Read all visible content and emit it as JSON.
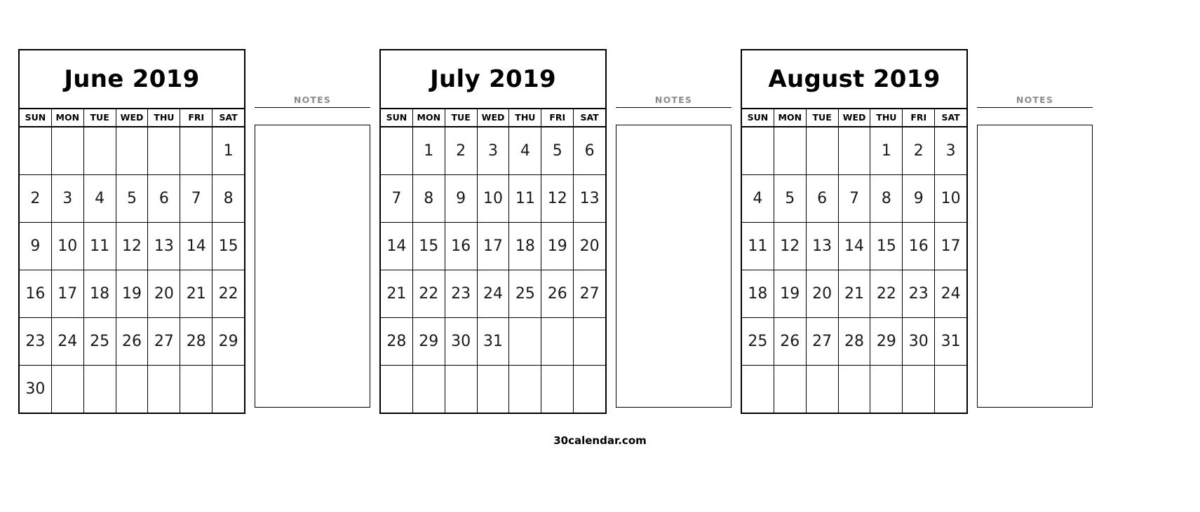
{
  "page": {
    "footer": "30calendar.com",
    "notes_label": "NOTES",
    "background": "#ffffff",
    "notes_label_color": "#8c8c8c",
    "border_color": "#000000"
  },
  "weekdays": [
    "SUN",
    "MON",
    "TUE",
    "WED",
    "THU",
    "FRI",
    "SAT"
  ],
  "months": [
    {
      "title": "June 2019",
      "name": "June",
      "year": "2019",
      "weeks": [
        [
          "",
          "",
          "",
          "",
          "",
          "",
          "1"
        ],
        [
          "2",
          "3",
          "4",
          "5",
          "6",
          "7",
          "8"
        ],
        [
          "9",
          "10",
          "11",
          "12",
          "13",
          "14",
          "15"
        ],
        [
          "16",
          "17",
          "18",
          "19",
          "20",
          "21",
          "22"
        ],
        [
          "23",
          "24",
          "25",
          "26",
          "27",
          "28",
          "29"
        ],
        [
          "30",
          "",
          "",
          "",
          "",
          "",
          ""
        ]
      ]
    },
    {
      "title": "July 2019",
      "name": "July",
      "year": "2019",
      "weeks": [
        [
          "",
          "1",
          "2",
          "3",
          "4",
          "5",
          "6"
        ],
        [
          "7",
          "8",
          "9",
          "10",
          "11",
          "12",
          "13"
        ],
        [
          "14",
          "15",
          "16",
          "17",
          "18",
          "19",
          "20"
        ],
        [
          "21",
          "22",
          "23",
          "24",
          "25",
          "26",
          "27"
        ],
        [
          "28",
          "29",
          "30",
          "31",
          "",
          "",
          ""
        ],
        [
          "",
          "",
          "",
          "",
          "",
          "",
          ""
        ]
      ]
    },
    {
      "title": "August 2019",
      "name": "August",
      "year": "2019",
      "weeks": [
        [
          "",
          "",
          "",
          "",
          "1",
          "2",
          "3"
        ],
        [
          "4",
          "5",
          "6",
          "7",
          "8",
          "9",
          "10"
        ],
        [
          "11",
          "12",
          "13",
          "14",
          "15",
          "16",
          "17"
        ],
        [
          "18",
          "19",
          "20",
          "21",
          "22",
          "23",
          "24"
        ],
        [
          "25",
          "26",
          "27",
          "28",
          "29",
          "30",
          "31"
        ],
        [
          "",
          "",
          "",
          "",
          "",
          "",
          ""
        ]
      ]
    }
  ]
}
